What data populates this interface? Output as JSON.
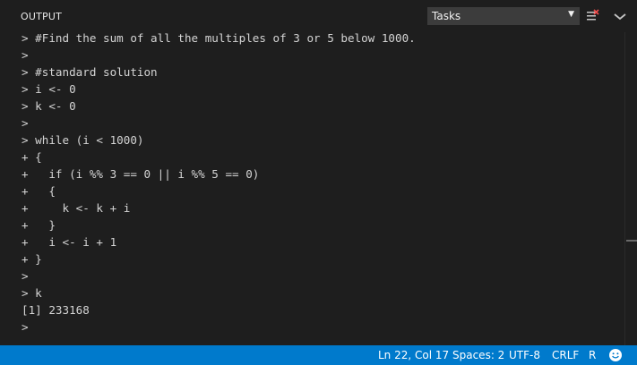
{
  "panel": {
    "title": "OUTPUT",
    "channel_select": {
      "value": "Tasks"
    }
  },
  "output_lines": [
    "> #Find the sum of all the multiples of 3 or 5 below 1000.",
    ">",
    "> #standard solution",
    "> i <- 0",
    "> k <- 0",
    ">",
    "> while (i < 1000)",
    "+ {",
    "+   if (i %% 3 == 0 || i %% 5 == 0)",
    "+   {",
    "+     k <- k + i",
    "+   }",
    "+   i <- i + 1",
    "+ }",
    ">",
    "> k",
    "[1] 233168",
    ">"
  ],
  "status_bar": {
    "position": "Ln 22, Col 17",
    "spaces": "Spaces: 2",
    "encoding": "UTF-8",
    "line_ending": "CRLF",
    "language": "R"
  },
  "icons": {
    "clear": "clear-output-icon",
    "collapse": "chevron-down-icon",
    "feedback": "smiley-icon"
  },
  "colors": {
    "background": "#1e1e1e",
    "status_bar": "#007acc",
    "select_bg": "#3c3c3c",
    "text": "#d4d4d4"
  }
}
